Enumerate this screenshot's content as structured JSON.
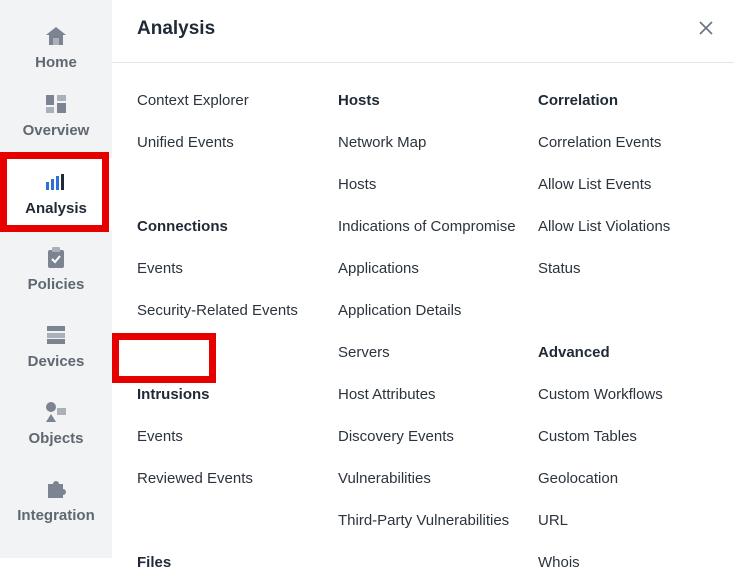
{
  "sidebar": {
    "items": [
      {
        "label": "Home",
        "icon": "home-icon"
      },
      {
        "label": "Overview",
        "icon": "dashboard-icon"
      },
      {
        "label": "Analysis",
        "icon": "bar-chart-icon",
        "active": true
      },
      {
        "label": "Policies",
        "icon": "clipboard-check-icon"
      },
      {
        "label": "Devices",
        "icon": "server-icon"
      },
      {
        "label": "Objects",
        "icon": "objects-icon"
      },
      {
        "label": "Integration",
        "icon": "puzzle-icon"
      }
    ]
  },
  "panel": {
    "title": "Analysis",
    "close_icon": "close-icon",
    "columns": [
      [
        {
          "text": "Context Explorer",
          "type": "link"
        },
        {
          "text": "Unified Events",
          "type": "link"
        },
        {
          "text": "",
          "type": "spacer"
        },
        {
          "text": "Connections",
          "type": "header"
        },
        {
          "text": "Events",
          "type": "link"
        },
        {
          "text": "Security-Related Events",
          "type": "link"
        },
        {
          "text": "",
          "type": "spacer"
        },
        {
          "text": "Intrusions",
          "type": "header"
        },
        {
          "text": "Events",
          "type": "link"
        },
        {
          "text": "Reviewed Events",
          "type": "link"
        },
        {
          "text": "",
          "type": "spacer"
        },
        {
          "text": "Files",
          "type": "header"
        }
      ],
      [
        {
          "text": "Hosts",
          "type": "header"
        },
        {
          "text": "Network Map",
          "type": "link"
        },
        {
          "text": "Hosts",
          "type": "link"
        },
        {
          "text": "Indications of Compromise",
          "type": "link"
        },
        {
          "text": "Applications",
          "type": "link"
        },
        {
          "text": "Application Details",
          "type": "link"
        },
        {
          "text": "Servers",
          "type": "link"
        },
        {
          "text": "Host Attributes",
          "type": "link"
        },
        {
          "text": "Discovery Events",
          "type": "link"
        },
        {
          "text": "Vulnerabilities",
          "type": "link"
        },
        {
          "text": "Third-Party Vulnerabilities",
          "type": "link"
        }
      ],
      [
        {
          "text": "Correlation",
          "type": "header"
        },
        {
          "text": "Correlation Events",
          "type": "link"
        },
        {
          "text": "Allow List Events",
          "type": "link"
        },
        {
          "text": "Allow List Violations",
          "type": "link"
        },
        {
          "text": "Status",
          "type": "link"
        },
        {
          "text": "",
          "type": "spacer"
        },
        {
          "text": "Advanced",
          "type": "header"
        },
        {
          "text": "Custom Workflows",
          "type": "link"
        },
        {
          "text": "Custom Tables",
          "type": "link"
        },
        {
          "text": "Geolocation",
          "type": "link"
        },
        {
          "text": "URL",
          "type": "link"
        },
        {
          "text": "Whois",
          "type": "link"
        }
      ]
    ]
  },
  "colors": {
    "highlight": "#e60000",
    "sidebar_bg": "#f2f3f5",
    "icon": "#6b7480",
    "active_icon": "#2e6fd8"
  }
}
